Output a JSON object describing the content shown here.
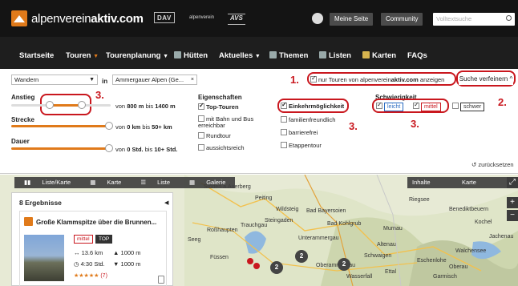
{
  "header": {
    "brand_light": "alpenverein",
    "brand_bold": "aktiv.com",
    "partner_dav": "DAV",
    "partner_oeav": "alpenverein",
    "partner_avs": "AVS",
    "my_page": "Meine Seite",
    "community": "Community",
    "search_placeholder": "Volltextsuche"
  },
  "nav": {
    "items": [
      {
        "label": "Startseite"
      },
      {
        "label": "Touren"
      },
      {
        "label": "Tourenplanung"
      },
      {
        "label": "Hütten"
      },
      {
        "label": "Aktuelles"
      },
      {
        "label": "Themen"
      },
      {
        "label": "Listen"
      },
      {
        "label": "Karten"
      },
      {
        "label": "FAQs"
      }
    ]
  },
  "filter": {
    "activity": "Wandern",
    "in_label": "in",
    "region": "Ammergauer Alpen (Ge...",
    "only_av": "nur Touren von alpenvereinaktiv.com anzeigen",
    "only_av_prefix": "nur Touren von alpenverein",
    "only_av_bold": "aktiv.com",
    "only_av_suffix": " anzeigen",
    "refine": "Suche verfeinern",
    "ascent_label": "Anstieg",
    "ascent_text_pre": "von",
    "ascent_from": "800 m",
    "ascent_mid": "bis",
    "ascent_to": "1400 m",
    "distance_label": "Strecke",
    "distance_from": "0 km",
    "distance_to": "50+ km",
    "duration_label": "Dauer",
    "duration_from": "0 Std.",
    "duration_to": "10+ Std.",
    "properties_title": "Eigenschaften",
    "top_tours": "Top-Touren",
    "by_train_bus": "mit Bahn und Bus erreichbar",
    "round_tour": "Rundtour",
    "viewpoint": "aussichtsreich",
    "hut_stop": "Einkehrmöglichkeit",
    "family": "familienfreundlich",
    "accessible": "barrierefrei",
    "stages": "Etappentour",
    "difficulty_title": "Schwierigkeit",
    "easy": "leicht",
    "medium": "mittel",
    "hard": "schwer",
    "reset": "zurücksetzen",
    "annotations": {
      "n1": "1.",
      "n2": "2.",
      "n3a": "3.",
      "n3b": "3.",
      "n3c": "3."
    }
  },
  "map": {
    "toolbar": {
      "list_map": "Liste/Karte",
      "map": "Karte",
      "list": "Liste",
      "gallery": "Galerie"
    },
    "tabs": {
      "content": "Inhalte",
      "map": "Karte"
    },
    "labels": [
      "Stötten a.Auerberg",
      "Peiting",
      "Bad Bayersoien",
      "Riegsee",
      "Benediktbeuern",
      "Kochel",
      "Füssen",
      "Seeg",
      "Roßhaupten",
      "Trauchgau",
      "Oberammergau",
      "Unterammergau",
      "Bad Kohlgrub",
      "Murnau",
      "Walchensee",
      "Jachenau",
      "Wildsteig",
      "Steingaden",
      "Altenau",
      "Schwaigen",
      "Ettal",
      "Eschenlohe",
      "Garmisch",
      "Wasserfall",
      "Oberau"
    ],
    "markers": [
      "2",
      "2",
      "2"
    ]
  },
  "results": {
    "count_title": "8 Ergebnisse",
    "card_title": "Große Klammspitze über die Brunnen...",
    "difficulty": "mittel",
    "badge_top": "TOP",
    "distance": "13.6 km",
    "ascent": "1000 m",
    "duration": "4:30 Std.",
    "descent": "1000 m",
    "rating": "★★★★★",
    "rating_count": "(7)"
  },
  "colors": {
    "accent": "#e07a1a",
    "annotation": "#c9171e",
    "header_bg": "#141414"
  }
}
